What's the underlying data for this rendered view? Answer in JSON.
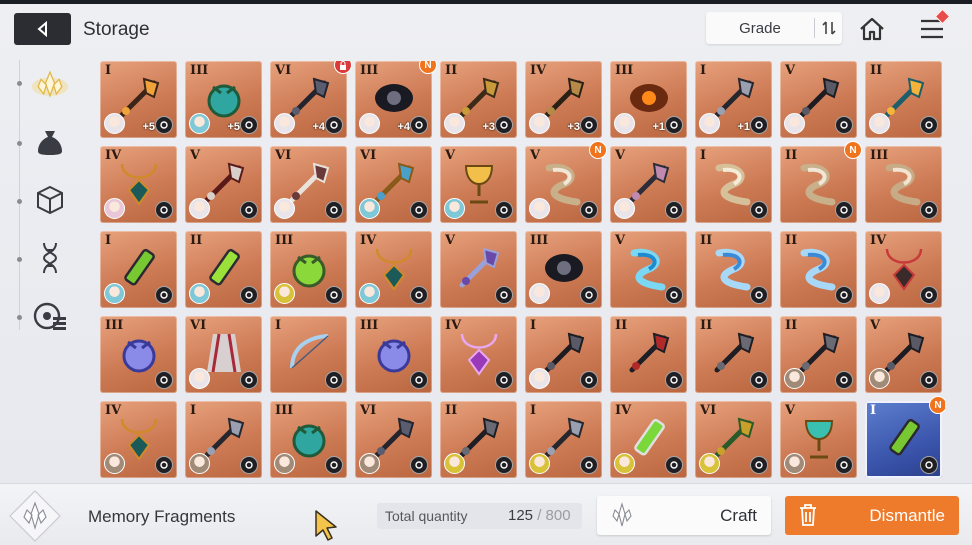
{
  "header": {
    "title": "Storage",
    "sort_label": "Grade",
    "back_icon": "back-arrow-icon",
    "home_icon": "home-icon",
    "menu_icon": "hamburger-menu-icon"
  },
  "sidebar": {
    "items": [
      {
        "icon": "memory-fragment-icon",
        "active": true
      },
      {
        "icon": "pouch-icon",
        "active": false
      },
      {
        "icon": "cube-icon",
        "active": false
      },
      {
        "icon": "dna-icon",
        "active": false
      },
      {
        "icon": "disc-list-icon",
        "active": false
      }
    ]
  },
  "colors": {
    "accent_orange": "#ee7a2b",
    "badge_new": "#f0731d",
    "card_bronze": "#cd7b55",
    "card_blue": "#3b56ad"
  },
  "items": [
    {
      "grade": "I",
      "plus": "+5",
      "art": "axe",
      "avatar": "#e8e4ea",
      "skill": "wing",
      "badge": ""
    },
    {
      "grade": "III",
      "plus": "+5",
      "art": "orb-green",
      "avatar": "#7ec8d8",
      "skill": "gear",
      "badge": ""
    },
    {
      "grade": "VI",
      "plus": "+4",
      "art": "feather-dark",
      "avatar": "#e8e4ea",
      "skill": "cross",
      "badge": "lock"
    },
    {
      "grade": "III",
      "plus": "+4",
      "art": "helm-dark",
      "avatar": "#e8e4ea",
      "skill": "wing",
      "badge": "N"
    },
    {
      "grade": "II",
      "plus": "+3",
      "art": "key",
      "avatar": "#e8e4ea",
      "skill": "wing",
      "badge": ""
    },
    {
      "grade": "IV",
      "plus": "+3",
      "art": "chain",
      "avatar": "#e8e4ea",
      "skill": "wing",
      "badge": ""
    },
    {
      "grade": "III",
      "plus": "+1",
      "art": "flame",
      "avatar": "#e8e4ea",
      "skill": "wing",
      "badge": ""
    },
    {
      "grade": "I",
      "plus": "+1",
      "art": "dagger",
      "avatar": "#e8e4ea",
      "skill": "wing",
      "badge": ""
    },
    {
      "grade": "V",
      "plus": "",
      "art": "claw-dark",
      "avatar": "#e8e4ea",
      "skill": "cross",
      "badge": ""
    },
    {
      "grade": "II",
      "plus": "",
      "art": "flower-gem",
      "avatar": "#e8e4ea",
      "skill": "gear",
      "badge": ""
    },
    {
      "grade": "IV",
      "plus": "",
      "art": "amulet",
      "avatar": "#e8c8d8",
      "skill": "gear",
      "badge": ""
    },
    {
      "grade": "V",
      "plus": "",
      "art": "scissor",
      "avatar": "#e8e4ea",
      "skill": "tri",
      "badge": ""
    },
    {
      "grade": "VI",
      "plus": "",
      "art": "feather-white",
      "avatar": "#e8e4ea",
      "skill": "tri",
      "badge": ""
    },
    {
      "grade": "VI",
      "plus": "",
      "art": "staff-gold",
      "avatar": "#7ec8d8",
      "skill": "trident",
      "badge": ""
    },
    {
      "grade": "V",
      "plus": "",
      "art": "chalice",
      "avatar": "#7ec8d8",
      "skill": "trident",
      "badge": ""
    },
    {
      "grade": "V",
      "plus": "",
      "art": "ribbon-white",
      "avatar": "#e8e4ea",
      "skill": "swirl",
      "badge": "N"
    },
    {
      "grade": "V",
      "plus": "",
      "art": "mace",
      "avatar": "#e8e4ea",
      "skill": "x",
      "badge": ""
    },
    {
      "grade": "I",
      "plus": "",
      "art": "wand-white",
      "avatar": "",
      "skill": "swirl",
      "badge": ""
    },
    {
      "grade": "II",
      "plus": "",
      "art": "ribbon-white",
      "avatar": "",
      "skill": "swirl",
      "badge": "N"
    },
    {
      "grade": "III",
      "plus": "",
      "art": "shell",
      "avatar": "",
      "skill": "bar",
      "badge": ""
    },
    {
      "grade": "I",
      "plus": "",
      "art": "vial",
      "avatar": "#7ec8d8",
      "skill": "moon",
      "badge": ""
    },
    {
      "grade": "II",
      "plus": "",
      "art": "syringe",
      "avatar": "#7ec8d8",
      "skill": "moon",
      "badge": ""
    },
    {
      "grade": "III",
      "plus": "",
      "art": "flask-green",
      "avatar": "#d8c23a",
      "skill": "moon",
      "badge": ""
    },
    {
      "grade": "IV",
      "plus": "",
      "art": "amulet",
      "avatar": "#7ec8d8",
      "skill": "moon",
      "badge": ""
    },
    {
      "grade": "V",
      "plus": "",
      "art": "perfume",
      "avatar": "",
      "skill": "heart",
      "badge": ""
    },
    {
      "grade": "III",
      "plus": "",
      "art": "helm-dark",
      "avatar": "#e8e4ea",
      "skill": "x",
      "badge": ""
    },
    {
      "grade": "V",
      "plus": "",
      "art": "wave-blue",
      "avatar": "",
      "skill": "scale",
      "badge": ""
    },
    {
      "grade": "II",
      "plus": "",
      "art": "ribbon-blue",
      "avatar": "",
      "skill": "heart",
      "badge": ""
    },
    {
      "grade": "II",
      "plus": "",
      "art": "ribbon-blue",
      "avatar": "",
      "skill": "heart",
      "badge": ""
    },
    {
      "grade": "IV",
      "plus": "",
      "art": "necklace",
      "avatar": "#e8e4ea",
      "skill": "x",
      "badge": ""
    },
    {
      "grade": "III",
      "plus": "",
      "art": "crystal-ball",
      "avatar": "",
      "skill": "heart",
      "badge": ""
    },
    {
      "grade": "VI",
      "plus": "",
      "art": "cape",
      "avatar": "#e8e4ea",
      "skill": "x",
      "badge": ""
    },
    {
      "grade": "I",
      "plus": "",
      "art": "bow",
      "avatar": "",
      "skill": "heart",
      "badge": ""
    },
    {
      "grade": "III",
      "plus": "",
      "art": "crystal-ball",
      "avatar": "",
      "skill": "heart",
      "badge": ""
    },
    {
      "grade": "IV",
      "plus": "",
      "art": "heart-locket",
      "avatar": "",
      "skill": "heart",
      "badge": ""
    },
    {
      "grade": "I",
      "plus": "",
      "art": "claw-dark",
      "avatar": "#e8e4ea",
      "skill": "cross",
      "badge": ""
    },
    {
      "grade": "II",
      "plus": "",
      "art": "spear-dark",
      "avatar": "",
      "skill": "cross",
      "badge": ""
    },
    {
      "grade": "II",
      "plus": "",
      "art": "bird-dark",
      "avatar": "",
      "skill": "wing",
      "badge": ""
    },
    {
      "grade": "II",
      "plus": "",
      "art": "bird-dark",
      "avatar": "#a08a78",
      "skill": "wing",
      "badge": ""
    },
    {
      "grade": "V",
      "plus": "",
      "art": "claw-dark",
      "avatar": "#a08a78",
      "skill": "cross",
      "badge": ""
    },
    {
      "grade": "IV",
      "plus": "",
      "art": "amulet",
      "avatar": "#a08a78",
      "skill": "gear",
      "badge": ""
    },
    {
      "grade": "I",
      "plus": "",
      "art": "dagger",
      "avatar": "#a08a78",
      "skill": "wing",
      "badge": ""
    },
    {
      "grade": "III",
      "plus": "",
      "art": "orb-green",
      "avatar": "#a08a78",
      "skill": "gear",
      "badge": ""
    },
    {
      "grade": "VI",
      "plus": "",
      "art": "feather-dark",
      "avatar": "#a08a78",
      "skill": "cross",
      "badge": ""
    },
    {
      "grade": "II",
      "plus": "",
      "art": "bird-dark",
      "avatar": "#d8c23a",
      "skill": "wing",
      "badge": ""
    },
    {
      "grade": "I",
      "plus": "",
      "art": "dagger",
      "avatar": "#d8c23a",
      "skill": "cross",
      "badge": ""
    },
    {
      "grade": "IV",
      "plus": "",
      "art": "chain-vial",
      "avatar": "#d8c23a",
      "skill": "wing",
      "badge": ""
    },
    {
      "grade": "VI",
      "plus": "",
      "art": "leaf-blade",
      "avatar": "#d8c23a",
      "skill": "wing",
      "badge": ""
    },
    {
      "grade": "V",
      "plus": "",
      "art": "chalice-teal",
      "avatar": "#a08a78",
      "skill": "gear",
      "badge": ""
    },
    {
      "grade": "I",
      "plus": "",
      "art": "vial",
      "avatar": "",
      "skill": "moon",
      "badge": "N",
      "blue": true
    }
  ],
  "footer": {
    "category_label": "Memory Fragments",
    "total_label": "Total quantity",
    "total_current": "125",
    "total_separator": " / ",
    "total_max": "800",
    "craft_label": "Craft",
    "dismantle_label": "Dismantle"
  }
}
